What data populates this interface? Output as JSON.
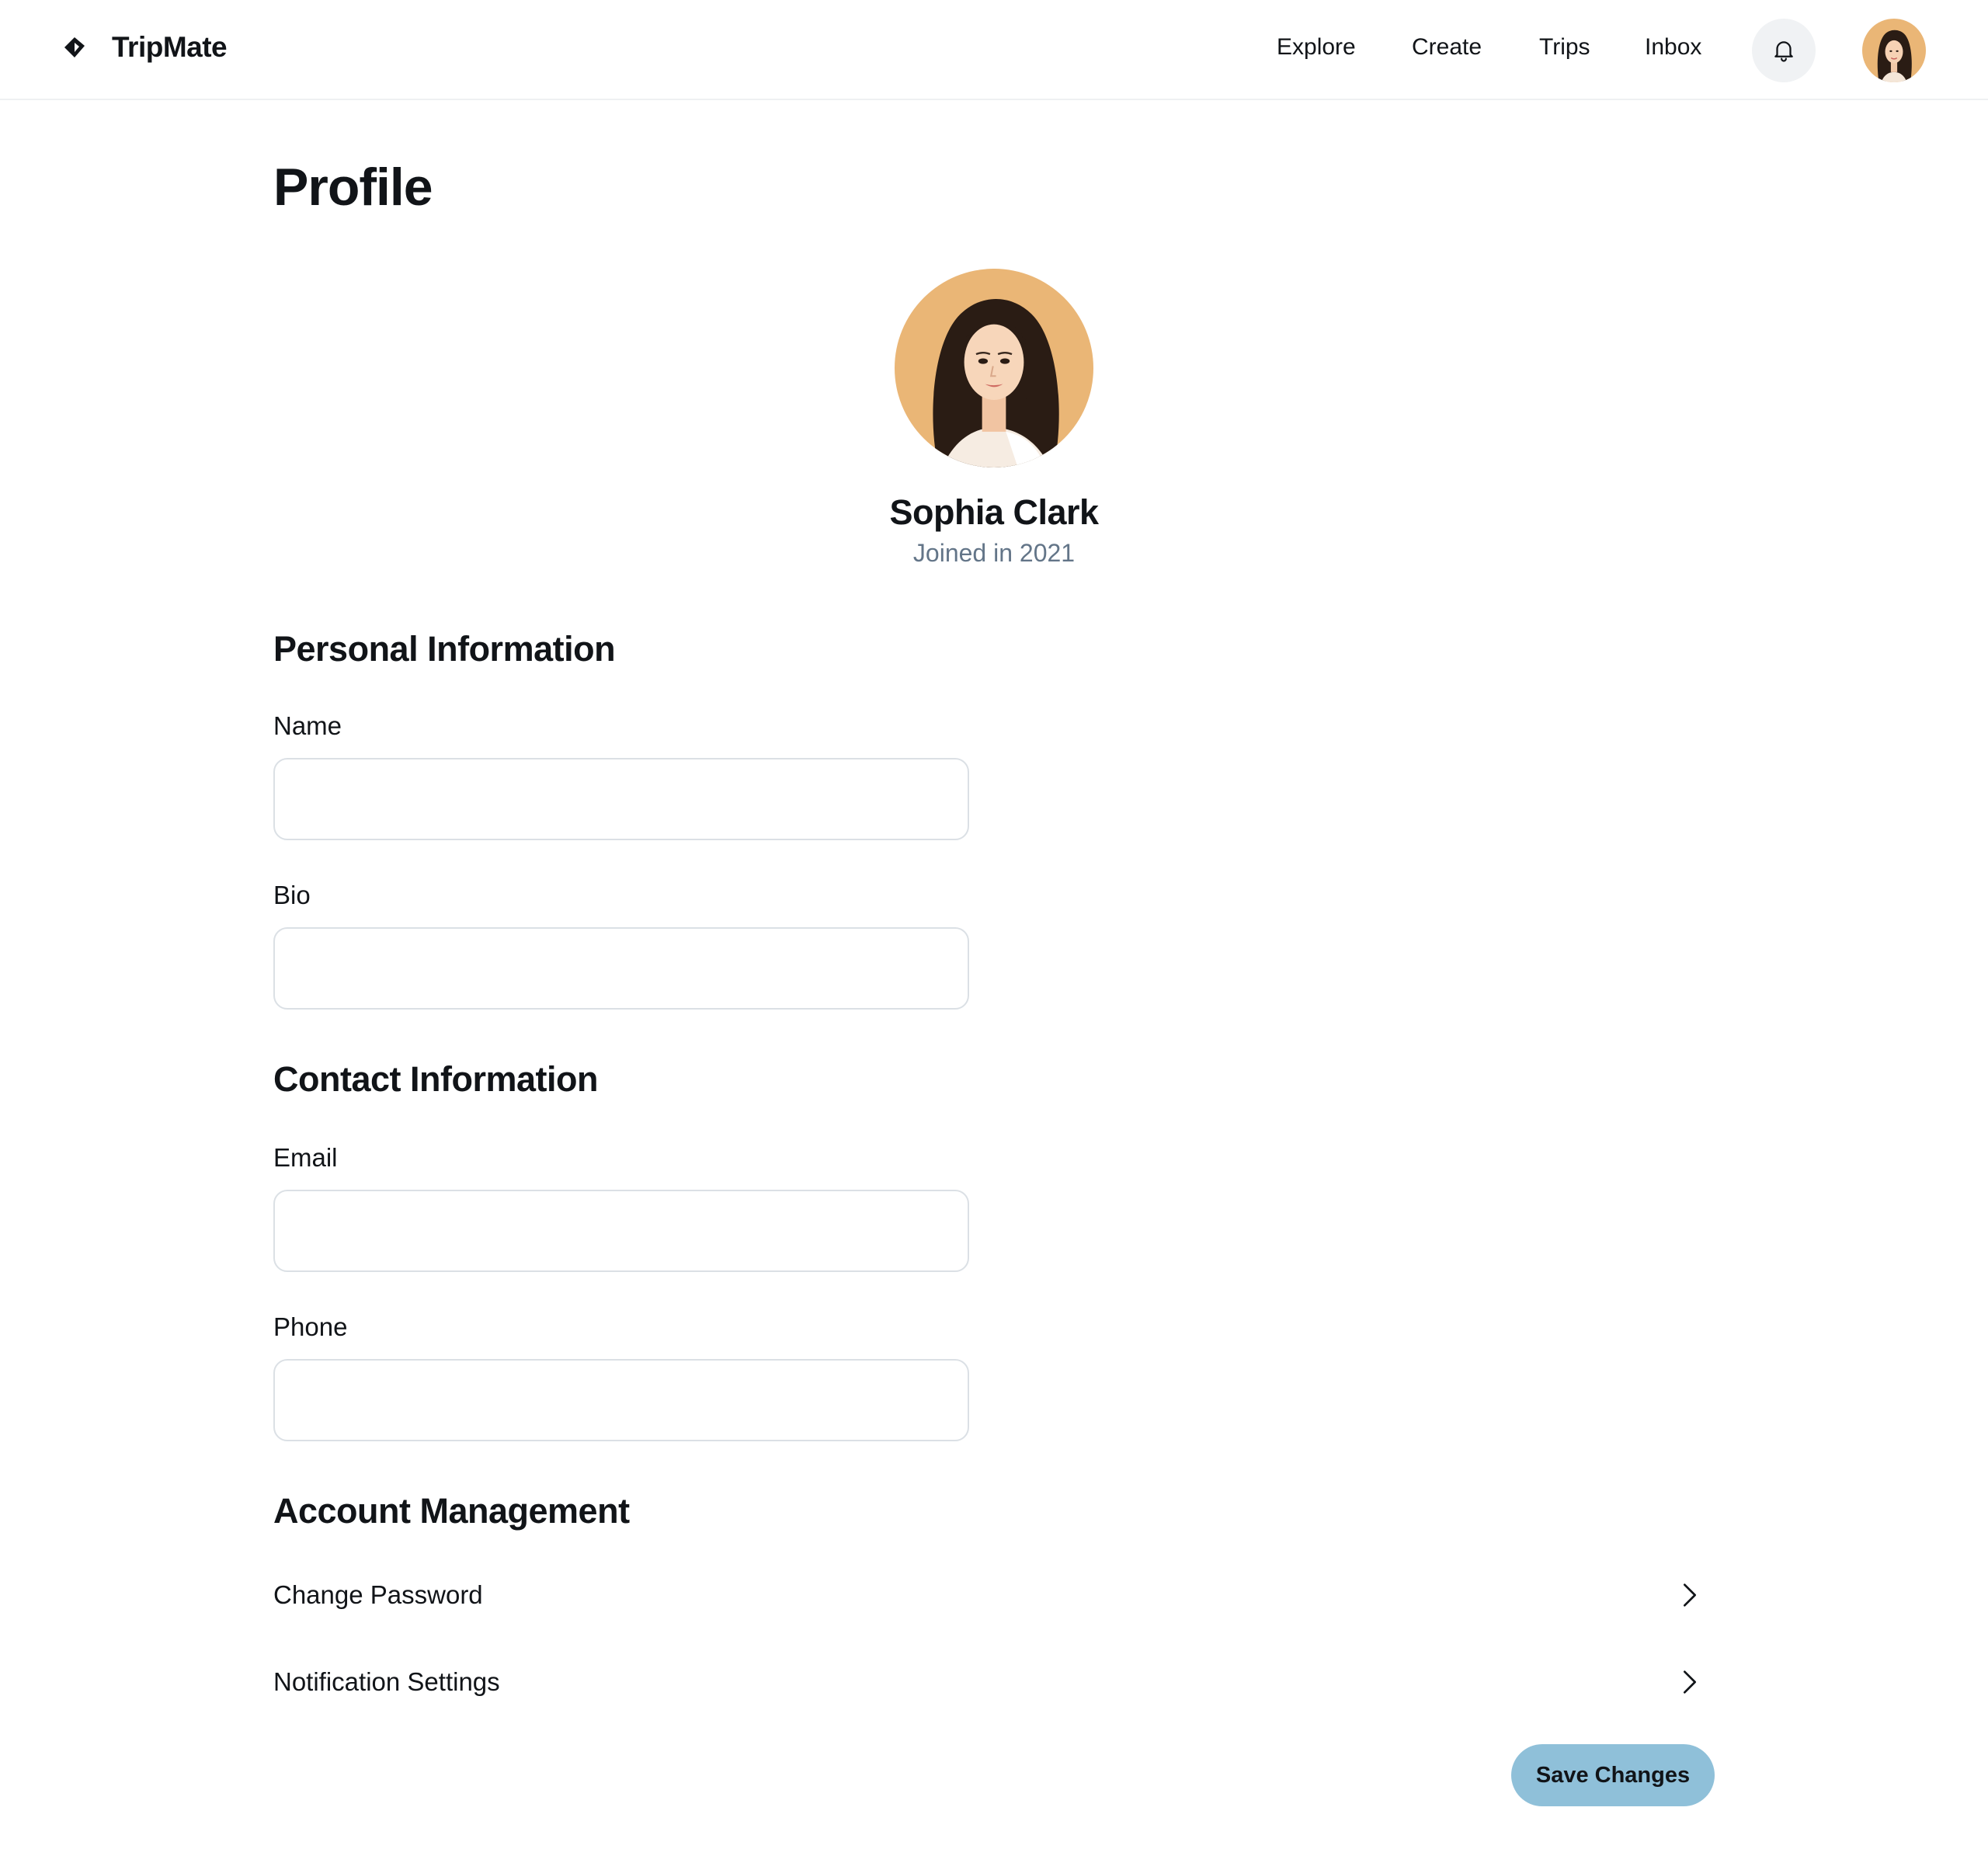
{
  "app": {
    "name": "TripMate"
  },
  "nav": {
    "items": [
      "Explore",
      "Create",
      "Trips",
      "Inbox"
    ]
  },
  "page": {
    "title": "Profile"
  },
  "profile": {
    "name": "Sophia Clark",
    "joined": "Joined in 2021"
  },
  "personal": {
    "title": "Personal Information",
    "name_label": "Name",
    "name_value": "",
    "bio_label": "Bio",
    "bio_value": ""
  },
  "contact": {
    "title": "Contact Information",
    "email_label": "Email",
    "email_value": "",
    "phone_label": "Phone",
    "phone_value": ""
  },
  "account": {
    "title": "Account Management",
    "items": [
      "Change Password",
      "Notification Settings"
    ]
  },
  "actions": {
    "save_label": "Save Changes"
  },
  "colors": {
    "accent": "#8fc0d9",
    "text": "#111418",
    "muted": "#637588",
    "border": "#dbe0e5",
    "avatar_bg": "#eab676"
  },
  "icons": {
    "logo": "tripmate-logo-icon",
    "bell": "bell-icon",
    "chevron": "chevron-right-icon"
  }
}
